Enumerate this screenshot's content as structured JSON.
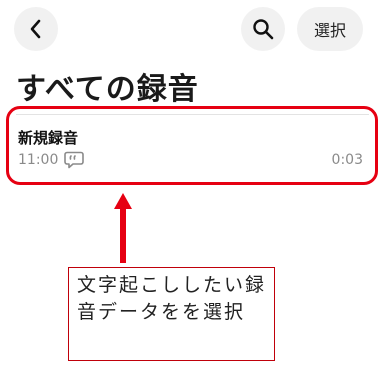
{
  "header": {
    "back_icon": "chevron-left-icon",
    "search_icon": "search-icon",
    "select_label": "選択"
  },
  "page_title": "すべての録音",
  "recordings": [
    {
      "title": "新規録音",
      "time": "11:00",
      "transcript_icon": "transcript-bubble-icon",
      "duration": "0:03"
    }
  ],
  "annotation": {
    "text": "文字起こししたい録音データをを選択",
    "highlight_color": "#e60012"
  }
}
